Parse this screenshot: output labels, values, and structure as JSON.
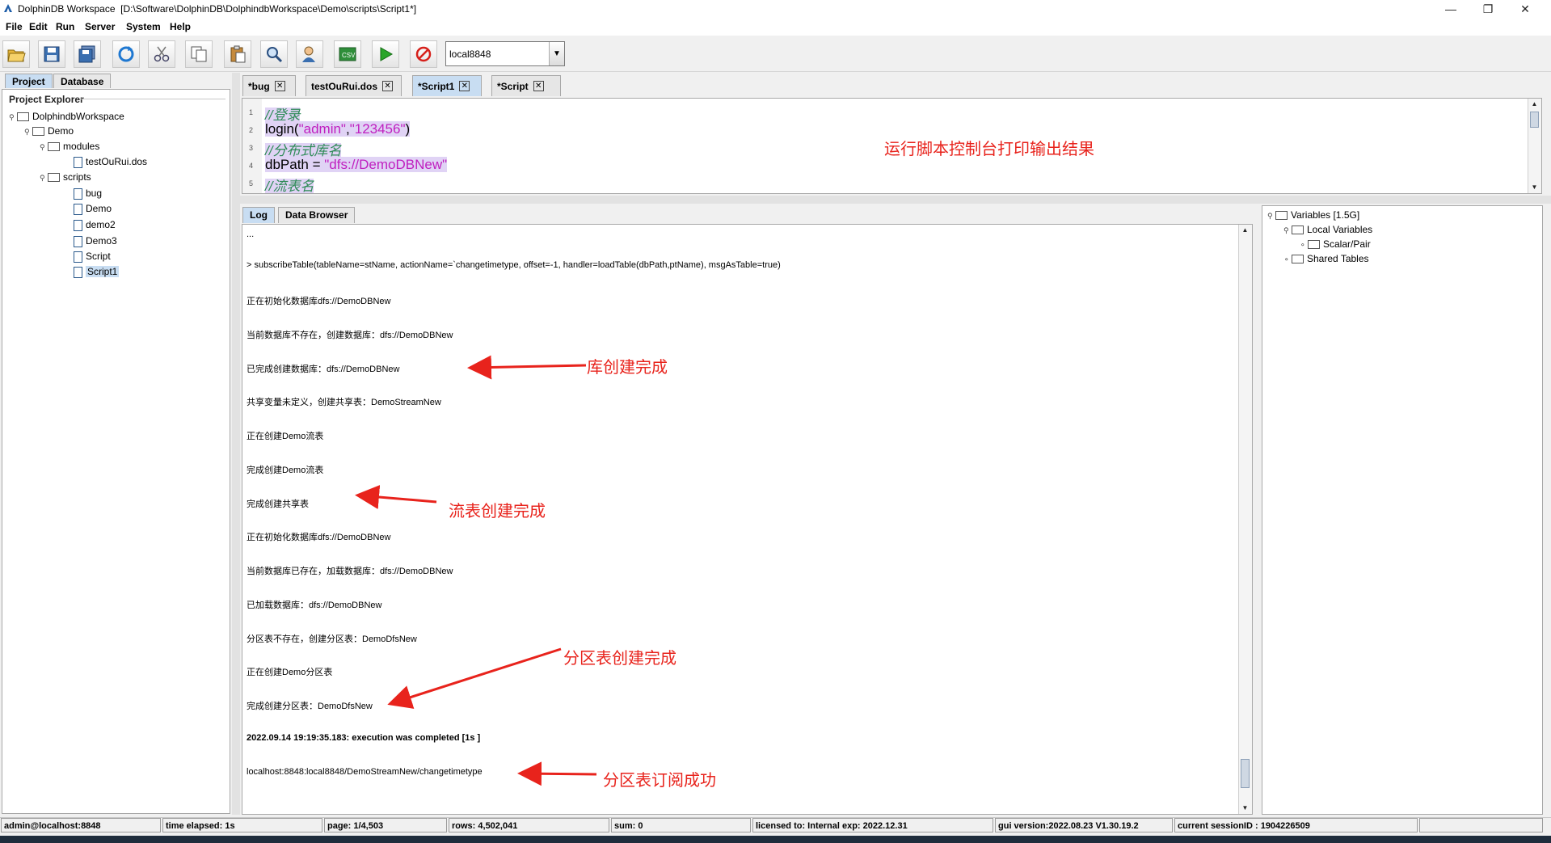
{
  "window": {
    "app_title": "DolphinDB Workspace",
    "path": "[D:\\Software\\DolphinDB\\DolphindbWorkspace\\Demo\\scripts\\Script1*]",
    "minimize": "—",
    "restore": "❐",
    "close": "✕"
  },
  "menu": [
    "File",
    "Edit",
    "Run",
    "Server",
    "System",
    "Help"
  ],
  "toolbar": {
    "icons": [
      "open-icon",
      "save-icon",
      "save-all-icon",
      "refresh-icon",
      "cut-icon",
      "copy-icon",
      "paste-icon",
      "find-icon",
      "user-icon",
      "export-icon",
      "run-icon",
      "stop-icon"
    ],
    "server": "local8848"
  },
  "left_tabs": [
    "Project",
    "Database"
  ],
  "project_explorer": {
    "header": "Project Explorer",
    "nodes": [
      {
        "label": "DolphindbWorkspace",
        "type": "folder"
      },
      {
        "label": "Demo",
        "type": "folder"
      },
      {
        "label": "modules",
        "type": "folder"
      },
      {
        "label": "testOuRui.dos",
        "type": "file"
      },
      {
        "label": "scripts",
        "type": "folder"
      },
      {
        "label": "bug",
        "type": "file"
      },
      {
        "label": "Demo",
        "type": "file"
      },
      {
        "label": "demo2",
        "type": "file"
      },
      {
        "label": "Demo3",
        "type": "file"
      },
      {
        "label": "Script",
        "type": "file"
      },
      {
        "label": "Script1",
        "type": "file",
        "selected": true
      }
    ]
  },
  "editor_tabs": [
    "*bug",
    "testOuRui.dos",
    "*Script1",
    "*Script"
  ],
  "editor": {
    "line_numbers": [
      "1",
      "2",
      "3",
      "4",
      "5"
    ],
    "line1": "//登录",
    "line2_fn": "login(",
    "line2_arg1": "\"admin\"",
    "line2_comma": ",",
    "line2_arg2": "\"123456\"",
    "line2_end": ")",
    "line3": "//分布式库名",
    "line4_var": "dbPath = ",
    "line4_str": "\"dfs://DemoDBNew\"",
    "line5": "//流表名"
  },
  "bottom_tabs": [
    "Log",
    "Data Browser"
  ],
  "log_lines": [
    "...",
    "> subscribeTable(tableName=stName, actionName=`changetimetype, offset=-1, handler=loadTable(dbPath,ptName), msgAsTable=true)",
    "正在初始化数据库dfs://DemoDBNew",
    "当前数据库不存在，创建数据库：dfs://DemoDBNew",
    "已完成创建数据库：dfs://DemoDBNew",
    "共享变量未定义，创建共享表：DemoStreamNew",
    "正在创建Demo流表",
    "完成创建Demo流表",
    "完成创建共享表",
    "正在初始化数据库dfs://DemoDBNew",
    "当前数据库已存在，加载数据库：dfs://DemoDBNew",
    "已加载数据库：dfs://DemoDBNew",
    "分区表不存在，创建分区表：DemoDfsNew",
    "正在创建Demo分区表",
    "完成创建分区表：DemoDfsNew",
    "2022.09.14 19:19:35.183: execution was completed [1s ]",
    "localhost:8848:local8848/DemoStreamNew/changetimetype"
  ],
  "variables": {
    "root": "Variables [1.5G]",
    "local": "Local Variables",
    "scalar": "Scalar/Pair",
    "shared": "Shared Tables"
  },
  "annotations": {
    "console": "运行脚本控制台打印输出结果",
    "db_created": "库创建完成",
    "stream_created": "流表创建完成",
    "partition_created": "分区表创建完成",
    "subscribed": "分区表订阅成功"
  },
  "status": {
    "user": "admin@localhost:8848",
    "elapsed": "time elapsed: 1s",
    "page": "page: 1/4,503",
    "rows": "rows: 4,502,041",
    "sum": "sum: 0",
    "license": "licensed to: Internal  exp: 2022.12.31",
    "gui_version": "gui version:2022.08.23 V1.30.19.2",
    "session": "current sessionID : 1904226509"
  },
  "colors": {
    "annotation": "#e8231c",
    "comment": "#2e8b57",
    "string": "#c020c0",
    "highlight": "#e0d3f5",
    "active_tab": "#c8ddf2"
  }
}
